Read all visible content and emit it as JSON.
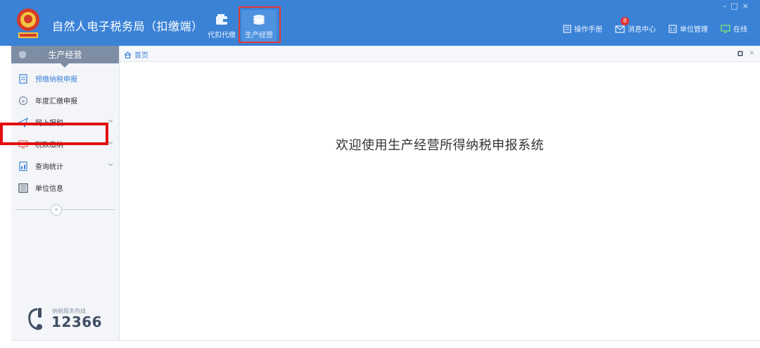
{
  "header": {
    "title": "自然人电子税务局（扣缴端）",
    "nav": [
      {
        "label": "代扣代缴",
        "icon": "wallet-icon"
      },
      {
        "label": "生产经营",
        "icon": "coins-icon",
        "active": true
      }
    ],
    "right": {
      "manual": "操作手册",
      "messages": "消息中心",
      "messages_badge": "8",
      "unit_mgmt": "单位管理",
      "online": "在线"
    }
  },
  "sidebar": {
    "title": "生产经营",
    "items": [
      {
        "label": "预缴纳税申报",
        "icon": "document-icon",
        "active": true
      },
      {
        "label": "年度汇缴申报",
        "icon": "yen-circle-icon"
      },
      {
        "label": "网上报税",
        "icon": "send-icon",
        "expandable": true
      },
      {
        "label": "税款缴纳",
        "icon": "monitor-icon",
        "expandable": true
      },
      {
        "label": "查询统计",
        "icon": "chart-doc-icon",
        "expandable": true
      },
      {
        "label": "单位信息",
        "icon": "list-icon"
      }
    ],
    "collapse": "«",
    "hotline_label": "纳税服务热线",
    "hotline_number": "12366"
  },
  "breadcrumb": {
    "home": "首页"
  },
  "content": {
    "welcome": "欢迎使用生产经营所得纳税申报系统"
  },
  "colors": {
    "header": "#3a82d6",
    "sidebar_head": "#7d8da4",
    "highlight": "#e20f0f"
  }
}
